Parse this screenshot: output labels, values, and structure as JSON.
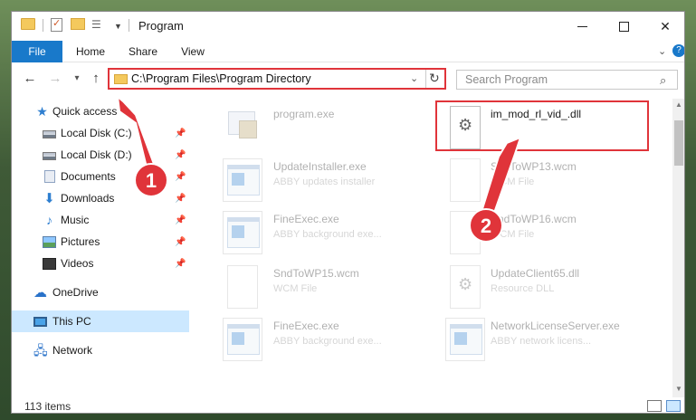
{
  "window": {
    "title": "Program"
  },
  "ribbon": {
    "tabs": [
      "File",
      "Home",
      "Share",
      "View"
    ]
  },
  "navigation": {
    "address": "C:\\Program Files\\Program Directory",
    "search_placeholder": "Search Program"
  },
  "sidebar": {
    "items": [
      {
        "label": "Quick access",
        "icon": "star-icon",
        "pinned": false
      },
      {
        "label": "Local Disk (C:)",
        "icon": "disk-icon",
        "pinned": true
      },
      {
        "label": "Local Disk (D:)",
        "icon": "disk-icon",
        "pinned": true
      },
      {
        "label": "Documents",
        "icon": "documents-icon",
        "pinned": true
      },
      {
        "label": "Downloads",
        "icon": "download-icon",
        "pinned": true
      },
      {
        "label": "Music",
        "icon": "music-icon",
        "pinned": true
      },
      {
        "label": "Pictures",
        "icon": "pictures-icon",
        "pinned": true
      },
      {
        "label": "Videos",
        "icon": "videos-icon",
        "pinned": true
      },
      {
        "label": "OneDrive",
        "icon": "onedrive-icon",
        "pinned": false
      },
      {
        "label": "This PC",
        "icon": "computer-icon",
        "pinned": false,
        "selected": true
      },
      {
        "label": "Network",
        "icon": "network-icon",
        "pinned": false
      }
    ]
  },
  "files": [
    {
      "name": "program.exe",
      "type": "",
      "icon": "program-icon",
      "faded": true
    },
    {
      "name": "im_mod_rl_vid_.dll",
      "type": "",
      "icon": "dll-icon",
      "faded": false,
      "highlighted": true
    },
    {
      "name": "UpdateInstaller.exe",
      "type": "ABBY updates installer",
      "icon": "exe-icon",
      "faded": true
    },
    {
      "name": "SndToWP13.wcm",
      "type": "WCM File",
      "icon": "document-icon",
      "faded": true
    },
    {
      "name": "FineExec.exe",
      "type": "ABBY background exe...",
      "icon": "exe-icon",
      "faded": true
    },
    {
      "name": "SndToWP16.wcm",
      "type": "WCM File",
      "icon": "document-icon",
      "faded": true
    },
    {
      "name": "SndToWP15.wcm",
      "type": "WCM File",
      "icon": "document-icon",
      "faded": true
    },
    {
      "name": "UpdateClient65.dll",
      "type": "Resource DLL",
      "icon": "dll-icon",
      "faded": true
    },
    {
      "name": "FineExec.exe",
      "type": "ABBY background exe...",
      "icon": "exe-icon",
      "faded": true
    },
    {
      "name": "NetworkLicenseServer.exe",
      "type": "ABBY network licens...",
      "icon": "exe-icon",
      "faded": true
    }
  ],
  "callouts": [
    "1",
    "2"
  ],
  "status": {
    "item_count": "113 items"
  },
  "colors": {
    "accent": "#1979ca",
    "annotation_red": "#e0343a",
    "selection": "#cce8ff"
  }
}
